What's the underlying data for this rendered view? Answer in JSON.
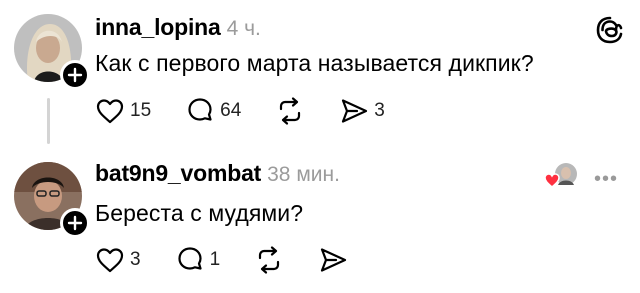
{
  "posts": [
    {
      "username": "inna_lopina",
      "time": "4 ч.",
      "text": "Как  с первого марта называется дикпик?",
      "likes": "15",
      "comments": "64",
      "shares": "3"
    },
    {
      "username": "bat9n9_vombat",
      "time": "38 мин.",
      "text": "Береста с мудями?",
      "likes": "3",
      "comments": "1"
    }
  ],
  "colors": {
    "text": "#000000",
    "muted": "#9b9b9b",
    "thread_line": "#d4d4d4",
    "heart": "#ff3040"
  },
  "icons": [
    "threads-logo-icon",
    "heart-icon",
    "comment-icon",
    "repost-icon",
    "share-icon",
    "plus-icon",
    "more-icon"
  ]
}
